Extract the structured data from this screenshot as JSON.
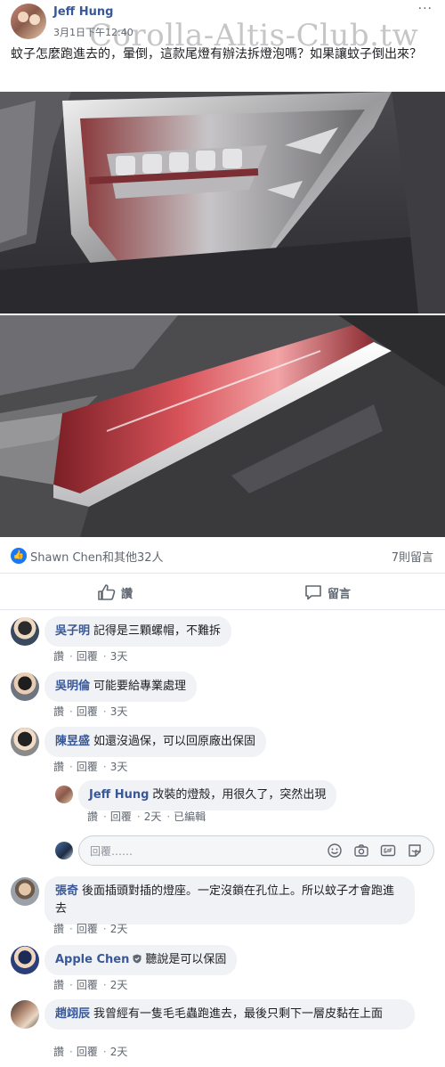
{
  "post": {
    "author": "Jeff Hung",
    "time": "3月1日下午12:40",
    "more": "···",
    "watermark": "Corolla-Altis-Club.tw",
    "text": "蚊子怎麼跑進去的，暈倒，這款尾燈有辦法拆燈泡嗎？如果讓蚊子倒出來？"
  },
  "reactions": {
    "summary": "Shawn Chen和其他32人",
    "comments_count": "7則留言"
  },
  "actions": {
    "like": "讚",
    "comment": "留言"
  },
  "comment_actions": {
    "like": "讚",
    "reply": "回覆",
    "sep": "·"
  },
  "comments": [
    {
      "name": "吳子明",
      "text": "記得是三顆螺帽，不難拆",
      "age": "3天"
    },
    {
      "name": "吳明倫",
      "text": "可能要給專業處理",
      "age": "3天"
    },
    {
      "name": "陳昱盛",
      "text": "如還沒過保，可以回原廠出保固",
      "age": "3天"
    },
    {
      "name": "Jeff Hung",
      "text": "改裝的燈殼，用很久了，突然出現",
      "age": "2天",
      "edited": "已編輯"
    },
    {
      "name": "張奇",
      "text": "後面插頭對插的燈座。一定沒鎖在孔位上。所以蚊子才會跑進去",
      "age": "2天"
    },
    {
      "name": "Apple Chen",
      "text": "聽說是可以保固",
      "age": "2天"
    },
    {
      "name": "趙翊辰",
      "text": "我曾經有一隻毛毛蟲跑進去，最後只剩下一層皮黏在上面",
      "age": "2天"
    }
  ],
  "reply_box": {
    "placeholder": "回覆……"
  },
  "colors": {
    "link": "#385898",
    "accent": "#1877f2",
    "bubble": "#f0f2f5",
    "muted": "#606770"
  }
}
